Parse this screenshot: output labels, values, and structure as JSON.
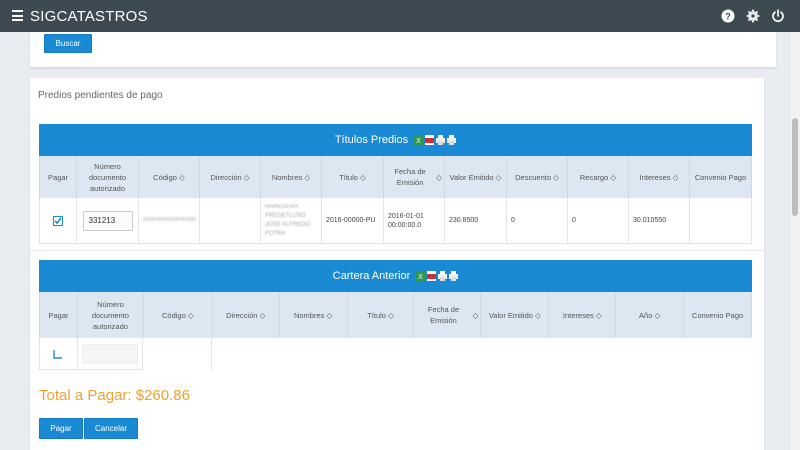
{
  "app": {
    "title": "SIGCATASTROS",
    "icons": [
      "help-icon",
      "gear-icon",
      "power-icon"
    ]
  },
  "search": {
    "button_label": "Buscar"
  },
  "section_title": "Predios pendientes de pago",
  "predios": {
    "title": "Títulos Predios",
    "export_icons": [
      "excel-icon",
      "pdf-icon",
      "print-icon",
      "print-icon"
    ],
    "columns": [
      "Pagar",
      "Número documento autorizado",
      "Código",
      "Dirección",
      "Nombres",
      "Título",
      "Fecha de Emisión",
      "Valor Emitido",
      "Descuento",
      "Recargo",
      "Intereses",
      "Convenio Pago"
    ],
    "rows": [
      {
        "checked": true,
        "doc_number": "331213",
        "codigo": "0000000000000090",
        "direccion": "",
        "nombres": "HAREDERA PREDETLUSO JOSE ALFREDO FOTRA",
        "titulo": "2016-00000-PU",
        "fecha": "2016-01-01 00:00:00.0",
        "valor": "230.8500",
        "descuento": "0",
        "recargo": "0",
        "intereses": "30.010550",
        "convenio": ""
      }
    ]
  },
  "cartera": {
    "title": "Cartera Anterior",
    "export_icons": [
      "excel-icon",
      "pdf-icon",
      "print-icon",
      "print-icon"
    ],
    "columns": [
      "Pagar",
      "Número documento autorizado",
      "Código",
      "Dirección",
      "Nombres",
      "Título",
      "Fecha de Emisión",
      "Valor Emitido",
      "Intereses",
      "Año",
      "Convenio Pago"
    ],
    "rows": [
      {
        "checked": false,
        "doc_number": ""
      }
    ]
  },
  "total": {
    "label": "Total a Pagar: $260.86"
  },
  "actions": {
    "pay_label": "Pagar",
    "cancel_label": "Cancelar"
  },
  "colors": {
    "accent": "#1a8ad4",
    "topbar": "#3d4a52",
    "total": "#f0a02c"
  }
}
